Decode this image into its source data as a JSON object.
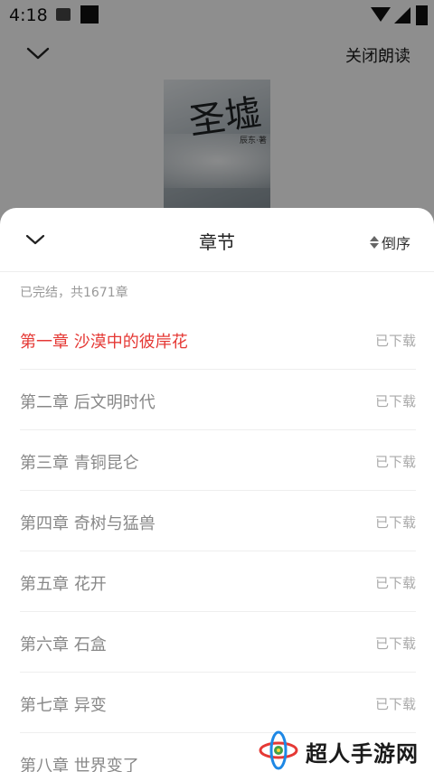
{
  "status_bar": {
    "time": "4:18"
  },
  "player": {
    "close_label": "关闭朗读",
    "cover_title": "圣墟",
    "cover_author": "辰东·著"
  },
  "sheet": {
    "title": "章节",
    "sort_label": "倒序",
    "summary": "已完结，共1671章",
    "chapters": [
      {
        "name": "第一章 沙漠中的彼岸花",
        "status": "已下载",
        "active": true
      },
      {
        "name": "第二章 后文明时代",
        "status": "已下载"
      },
      {
        "name": "第三章 青铜昆仑",
        "status": "已下载"
      },
      {
        "name": "第四章 奇树与猛兽",
        "status": "已下载"
      },
      {
        "name": "第五章 花开",
        "status": "已下载"
      },
      {
        "name": "第六章 石盒",
        "status": "已下载"
      },
      {
        "name": "第七章 异变",
        "status": "已下载"
      },
      {
        "name": "第八章 世界变了",
        "status": ""
      }
    ]
  },
  "watermark": {
    "text": "超人手游网"
  },
  "colors": {
    "accent": "#e53935",
    "muted_text": "#888888",
    "divider": "#eeeeee"
  }
}
